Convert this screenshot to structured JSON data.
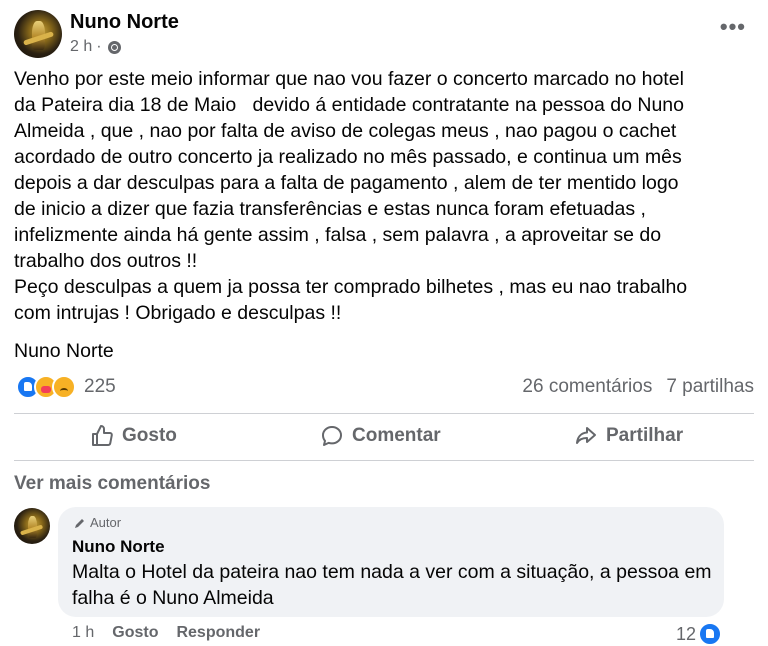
{
  "post": {
    "author": "Nuno Norte",
    "time": "2 h",
    "separator": "·",
    "more_label": "•••",
    "body": "Venho por este meio informar que nao vou fazer o concerto marcado no hotel\nda Pateira dia 18 de Maio   devido á entidade contratante na pessoa do Nuno\nAlmeida , que , nao por falta de aviso de colegas meus , nao pagou o cachet\nacordado de outro concerto ja realizado no mês passado, e continua um mês\ndepois a dar desculpas para a falta de pagamento , alem de ter mentido logo\nde inicio a dizer que fazia transferências e estas nunca foram efetuadas ,\ninfelizmente ainda há gente assim , falsa , sem palavra , a aproveitar se do\ntrabalho dos outros !!\nPeço desculpas a quem ja possa ter comprado bilhetes , mas eu nao trabalho\ncom intrujas ! Obrigado e desculpas !!",
    "signature": "Nuno Norte"
  },
  "stats": {
    "reaction_icons": [
      "like-icon",
      "care-icon",
      "sad-icon"
    ],
    "reaction_count": "225",
    "comments": "26 comentários",
    "shares": "7 partilhas"
  },
  "actions": {
    "like": "Gosto",
    "comment": "Comentar",
    "share": "Partilhar"
  },
  "more_comments": "Ver mais comentários",
  "comment": {
    "badge": "Autor",
    "author": "Nuno Norte",
    "text": "Malta o Hotel da pateira nao tem nada a ver com a situação, a pessoa em falha é o Nuno Almeida",
    "time": "1 h",
    "like_label": "Gosto",
    "reply_label": "Responder",
    "likes": "12"
  },
  "colors": {
    "secondary_text": "#65676b",
    "facebook_blue": "#1877f2",
    "comment_bg": "#f0f2f5"
  }
}
